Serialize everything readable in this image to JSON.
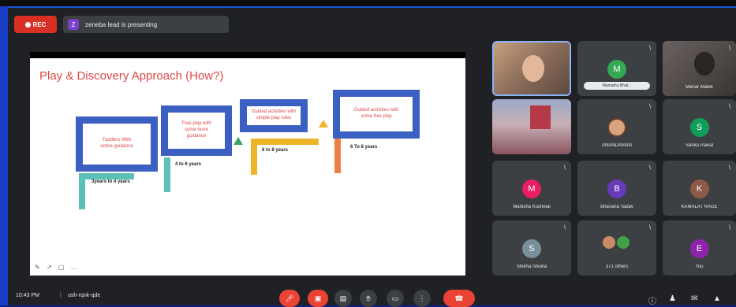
{
  "topbar": {
    "rec_label": "REC",
    "presenting_text": "zeneba lead is presenting",
    "presenter_initial": "Z"
  },
  "slide": {
    "title": "Play & Discovery Approach (How?)",
    "steps": [
      {
        "text": "Toddlers With active guidance",
        "age": "3years to 4 years"
      },
      {
        "text": "Free play with some more guidance",
        "age": "4 to 6 years"
      },
      {
        "text": "Guided activities with simple play rules",
        "age": "6 to 8 years"
      },
      {
        "text": "Guided activities with some free play",
        "age": "6 To 8 years"
      }
    ],
    "tools": "✎ ↗ ▢ …"
  },
  "participants": [
    {
      "name": "",
      "type": "photo-face"
    },
    {
      "name": "Mamatha Bhat...",
      "initial": "M",
      "color": "#34a853",
      "type": "avatar-pill"
    },
    {
      "name": "Manar Malek",
      "type": "photo-dark"
    },
    {
      "name": "",
      "type": "photo-crowd"
    },
    {
      "name": "ANANDAVANI",
      "type": "avatar-photo"
    },
    {
      "name": "Sarika Pawal",
      "initial": "S",
      "color": "#0f9d58",
      "type": "avatar"
    },
    {
      "name": "Manisha Kuchelal",
      "initial": "M",
      "color": "#e91e63",
      "type": "avatar"
    },
    {
      "name": "Bhavana Yadav",
      "initial": "B",
      "color": "#673ab7",
      "type": "avatar"
    },
    {
      "name": "KAMALAT RAGE",
      "initial": "K",
      "color": "#8d5a4a",
      "type": "avatar"
    },
    {
      "name": "Shikha Shukla",
      "initial": "S",
      "color": "#78909c",
      "type": "avatar"
    },
    {
      "name": "371 others",
      "type": "others"
    },
    {
      "name": "You",
      "initial": "E",
      "color": "#8e24aa",
      "type": "avatar"
    }
  ],
  "bottombar": {
    "time": "10:43 PM",
    "meeting_code": "ush-rqnk-qde"
  },
  "colors": {
    "rec": "#d93025",
    "slide_box_border": "#3c5fc2",
    "slide_text": "#e04848",
    "bar_teal": "#5bc0b8",
    "bar_gold": "#f0b429",
    "bar_orange": "#ef7d45",
    "hangup": "#ea4335"
  }
}
